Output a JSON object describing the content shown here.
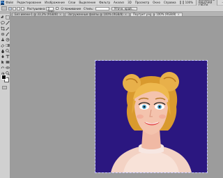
{
  "menubar": {
    "logo": "Ps",
    "items": [
      "Файл",
      "Редактирование",
      "Изображение",
      "Слои",
      "Выделение",
      "Фильтр",
      "Анализ",
      "3D",
      "Просмотр",
      "Окно",
      "Справка"
    ],
    "zoom": "100%",
    "workspace": "ОСНОВНАЯ РАБОЧАЯ СРЕДА"
  },
  "options": {
    "feather_label": "Растушевка:",
    "feather_value": "0 пикс.",
    "antialias_label": "Сглаживание",
    "style_label": "Стиль:",
    "refine_button": "Уточн. край..."
  },
  "tabs": [
    {
      "label": "Без имени-1 @ 33,3% (RGB/8)",
      "close": "×"
    },
    {
      "label": "Загруженные файлы @ 100% (RGB/8)",
      "close": "×"
    },
    {
      "label": "Портрет.png @ 100% (RGB/8)",
      "close": "×"
    }
  ],
  "colors": {
    "foreground": "#000000",
    "background": "#ffffff",
    "canvas_bg": "#2b1780"
  },
  "tools": [
    "move-icon",
    "marquee-icon",
    "lasso-icon",
    "magic-wand-icon",
    "crop-icon",
    "eyedropper-icon",
    "healing-brush-icon",
    "brush-icon",
    "clone-stamp-icon",
    "history-brush-icon",
    "eraser-icon",
    "gradient-icon",
    "blur-icon",
    "dodge-icon",
    "pen-icon",
    "type-icon",
    "path-select-icon",
    "shape-icon",
    "3d-rotate-icon",
    "3d-orbit-icon",
    "hand-icon",
    "zoom-icon"
  ]
}
